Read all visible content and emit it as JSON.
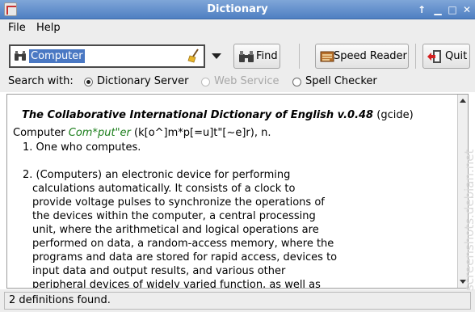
{
  "window": {
    "title": "Dictionary"
  },
  "menu": {
    "file": "File",
    "help": "Help"
  },
  "search": {
    "value": "Computer"
  },
  "toolbar": {
    "find_label": "Find",
    "speed_reader_label": "Speed Reader",
    "quit_label": "Quit"
  },
  "search_with": {
    "label": "Search with:",
    "options": [
      {
        "label": "Dictionary Server",
        "selected": true,
        "enabled": true
      },
      {
        "label": "Web Service",
        "selected": false,
        "enabled": false
      },
      {
        "label": "Spell Checker",
        "selected": false,
        "enabled": true
      }
    ]
  },
  "definition": {
    "source_title": "The Collaborative International Dictionary of English v.0.48",
    "source_code": "(gcide)",
    "headword": "Computer",
    "headword_syllables": "Com*put\"er",
    "pronunciation": "(k[o^]m*p[=u]t\"[~e]r), n.",
    "senses": [
      {
        "lines": [
          "1. One who computes."
        ]
      },
      {
        "lines": [
          "2. (Computers) an electronic device for performing",
          "calculations automatically. It consists of a clock to",
          "provide voltage pulses to synchronize the operations of",
          "the devices within the computer, a central processing",
          "unit, where the arithmetical and logical operations are",
          "performed on data, a random-access memory, where the",
          "programs and data are stored for rapid access, devices to",
          "input data and output results, and various other",
          "peripheral devices of widely varied function, as well as"
        ]
      }
    ]
  },
  "status": {
    "text": "2 definitions found."
  },
  "watermark": "screenshots.debian.net",
  "icons": {
    "app": "dictionary-app-icon",
    "find": "binoculars-icon",
    "clear": "broom-icon",
    "speed_reader": "speed-reader-icon",
    "quit": "exit-door-icon"
  }
}
